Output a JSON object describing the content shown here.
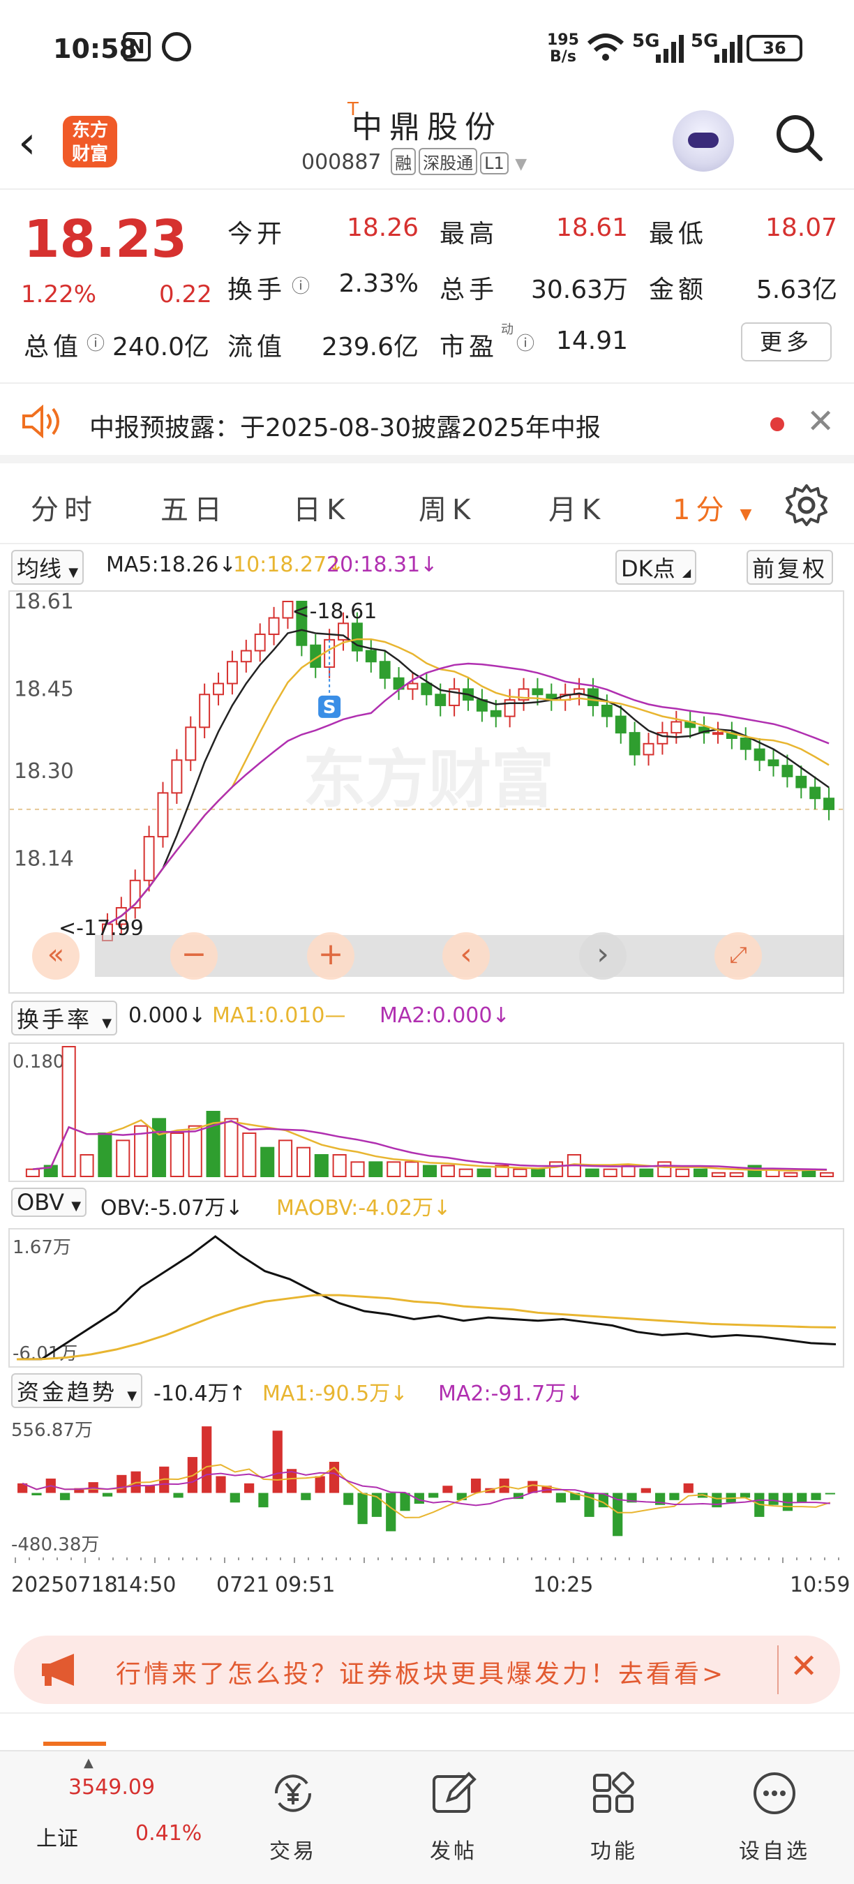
{
  "status_bar": {
    "time": "10:58",
    "net_speed_value": "195",
    "net_speed_unit": "B/s",
    "sim1": "5G",
    "sim2": "5G",
    "battery": "36",
    "icons": [
      "nfc-icon",
      "alarm-icon",
      "wifi-icon",
      "signal-icon",
      "battery-icon"
    ]
  },
  "header": {
    "back_icon": "chevron-left-icon",
    "logo_line1": "东方",
    "logo_line2": "财富",
    "t_mark": "T",
    "stock_name": "中鼎股份",
    "stock_code": "000887",
    "tags": [
      "融",
      "深股通",
      "L1"
    ],
    "search_icon": "search-icon"
  },
  "quote": {
    "price": "18.23",
    "change_pct": "1.22%",
    "change": "0.22",
    "fields": [
      {
        "label": "今开",
        "value": "18.26",
        "color": "red"
      },
      {
        "label": "最高",
        "value": "18.61",
        "color": "red"
      },
      {
        "label": "最低",
        "value": "18.07",
        "color": "red"
      },
      {
        "label": "换手",
        "value": "2.33%",
        "color": "black",
        "info": true
      },
      {
        "label": "总手",
        "value": "30.63万",
        "color": "black"
      },
      {
        "label": "金额",
        "value": "5.63亿",
        "color": "black"
      },
      {
        "label": "总值",
        "value": "240.0亿",
        "color": "black",
        "info": true
      },
      {
        "label": "流值",
        "value": "239.6亿",
        "color": "black"
      },
      {
        "label": "市盈",
        "value": "14.91",
        "color": "black",
        "info": true,
        "sup": "动"
      }
    ],
    "more_label": "更多"
  },
  "notice": {
    "text": "中报预披露：于2025-08-30披露2025年中报"
  },
  "tabs": [
    "分时",
    "五日",
    "日K",
    "周K",
    "月K",
    "1分"
  ],
  "active_tab": "1分",
  "main_chart": {
    "selector": "均线",
    "ma5": "MA5:18.26↓",
    "ma10": "10:18.27↓",
    "ma20": "20:18.31↓",
    "dk": "DK点",
    "adjust": "前复权",
    "y_ticks": [
      "18.61",
      "18.45",
      "18.30",
      "18.14"
    ],
    "high_label": "<-18.61",
    "low_label": "<-17.99",
    "signal": "S",
    "watermark": "东方财富"
  },
  "chart_data": [
    {
      "type": "candlestick",
      "title": "1分K",
      "ylim": [
        17.99,
        18.61
      ],
      "y_ticks": [
        18.61,
        18.45,
        18.3,
        18.14
      ],
      "grid": false,
      "prev_close": 18.23,
      "x": [
        "14:50",
        "09:51",
        "10:25",
        "10:59"
      ],
      "close": [
        18.02,
        18.05,
        18.1,
        18.18,
        18.26,
        18.32,
        18.38,
        18.44,
        18.46,
        18.5,
        18.52,
        18.55,
        18.58,
        18.61,
        18.53,
        18.49,
        18.54,
        18.57,
        18.52,
        18.5,
        18.47,
        18.45,
        18.46,
        18.44,
        18.42,
        18.45,
        18.43,
        18.41,
        18.4,
        18.43,
        18.45,
        18.44,
        18.43,
        18.44,
        18.45,
        18.42,
        18.4,
        18.37,
        18.33,
        18.35,
        18.37,
        18.39,
        18.38,
        18.37,
        18.37,
        18.36,
        18.34,
        18.32,
        18.31,
        18.29,
        18.27,
        18.25,
        18.23
      ],
      "series": [
        {
          "name": "MA5",
          "value_last": 18.26
        },
        {
          "name": "MA10",
          "value_last": 18.27
        },
        {
          "name": "MA20",
          "value_last": 18.31
        }
      ]
    },
    {
      "type": "bar",
      "title": "换手率",
      "ylim": [
        0,
        0.18
      ],
      "values": [
        0.01,
        0.015,
        0.18,
        0.03,
        0.06,
        0.05,
        0.07,
        0.08,
        0.06,
        0.07,
        0.09,
        0.08,
        0.06,
        0.04,
        0.05,
        0.04,
        0.03,
        0.03,
        0.02,
        0.02,
        0.02,
        0.02,
        0.015,
        0.015,
        0.01,
        0.01,
        0.015,
        0.01,
        0.01,
        0.02,
        0.03,
        0.01,
        0.01,
        0.015,
        0.01,
        0.02,
        0.01,
        0.01,
        0.005,
        0.005,
        0.015,
        0.01,
        0.005,
        0.01,
        0.005
      ],
      "series": [
        {
          "name": "MA1",
          "value_last": 0.01
        },
        {
          "name": "MA2",
          "value_last": 0.0
        }
      ]
    },
    {
      "type": "line",
      "title": "OBV",
      "ylim": [
        -6.01,
        1.67
      ],
      "y_unit": "万",
      "series": [
        {
          "name": "OBV",
          "values": [
            -6.01,
            -6.0,
            -5.0,
            -4.0,
            -3.0,
            -1.5,
            -0.5,
            0.5,
            1.67,
            0.5,
            -0.5,
            -1.0,
            -1.8,
            -2.5,
            -3.0,
            -3.2,
            -3.5,
            -3.3,
            -3.6,
            -3.4,
            -3.5,
            -3.6,
            -3.5,
            -3.7,
            -3.9,
            -4.3,
            -4.5,
            -4.4,
            -4.6,
            -4.5,
            -4.6,
            -4.8,
            -5.0,
            -5.07
          ]
        },
        {
          "name": "MAOBV",
          "values": [
            -6.01,
            -6.0,
            -5.9,
            -5.7,
            -5.4,
            -5.0,
            -4.5,
            -3.9,
            -3.3,
            -2.8,
            -2.4,
            -2.2,
            -2.0,
            -2.0,
            -2.1,
            -2.2,
            -2.4,
            -2.5,
            -2.7,
            -2.8,
            -2.9,
            -3.1,
            -3.2,
            -3.3,
            -3.4,
            -3.5,
            -3.6,
            -3.7,
            -3.8,
            -3.85,
            -3.9,
            -3.95,
            -4.0,
            -4.02
          ]
        }
      ],
      "labels": {
        "OBV": "-5.07万",
        "MAOBV": "-4.02万"
      }
    },
    {
      "type": "bar",
      "title": "资金趋势",
      "ylim": [
        -480.38,
        556.87
      ],
      "y_unit": "万",
      "values": [
        80,
        -20,
        120,
        -60,
        40,
        90,
        -30,
        150,
        180,
        60,
        220,
        -40,
        300,
        556,
        140,
        -80,
        80,
        -120,
        520,
        200,
        -60,
        140,
        260,
        -100,
        -260,
        -200,
        -320,
        -150,
        -90,
        -40,
        60,
        -60,
        120,
        40,
        120,
        -50,
        100,
        60,
        -80,
        -60,
        -200,
        -120,
        -360,
        -80,
        40,
        -100,
        -60,
        80,
        -40,
        -120,
        -80,
        -40,
        -200,
        -100,
        -150,
        -80,
        -60,
        -10
      ],
      "series": [
        {
          "name": "MA1",
          "value_last": -90.5
        },
        {
          "name": "MA2",
          "value_last": -91.7
        }
      ],
      "labels": {
        "value": "-10.4万",
        "MA1": "-90.5万",
        "MA2": "-91.7万"
      }
    }
  ],
  "turnover_panel": {
    "selector": "换手率",
    "value": "0.000↓",
    "ma1": "MA1:0.010—",
    "ma2": "MA2:0.000↓",
    "top_tick": "0.180"
  },
  "obv_panel": {
    "selector": "OBV",
    "value": "OBV:-5.07万↓",
    "ma": "MAOBV:-4.02万↓",
    "top_tick": "1.67万",
    "bottom_tick": "-6.01万"
  },
  "fund_panel": {
    "selector": "资金趋势",
    "value": "-10.4万↑",
    "ma1": "MA1:-90.5万↓",
    "ma2": "MA2:-91.7万↓",
    "top_tick": "556.87万",
    "bottom_tick": "-480.38万"
  },
  "time_axis": {
    "date": "20250718",
    "t1": "14:50",
    "t2": "0721",
    "t3": "09:51",
    "t4": "10:25",
    "t5": "10:59"
  },
  "banner": {
    "text": "行情来了怎么投？证券板块更具爆发力！去看看>"
  },
  "bottom_nav": {
    "index_value": "3549.09",
    "index_name": "上证",
    "index_pct": "0.41%",
    "items": [
      {
        "label": "交易",
        "icon": "yen-exchange-icon"
      },
      {
        "label": "发帖",
        "icon": "edit-icon"
      },
      {
        "label": "功能",
        "icon": "grid-icon"
      },
      {
        "label": "设自选",
        "icon": "more-dots-icon"
      }
    ]
  },
  "colors": {
    "up": "#d6312f",
    "down": "#2f9e2f",
    "ma5": "#222222",
    "ma10": "#e8b530",
    "ma20": "#b02fb0",
    "accent": "#f07020"
  }
}
